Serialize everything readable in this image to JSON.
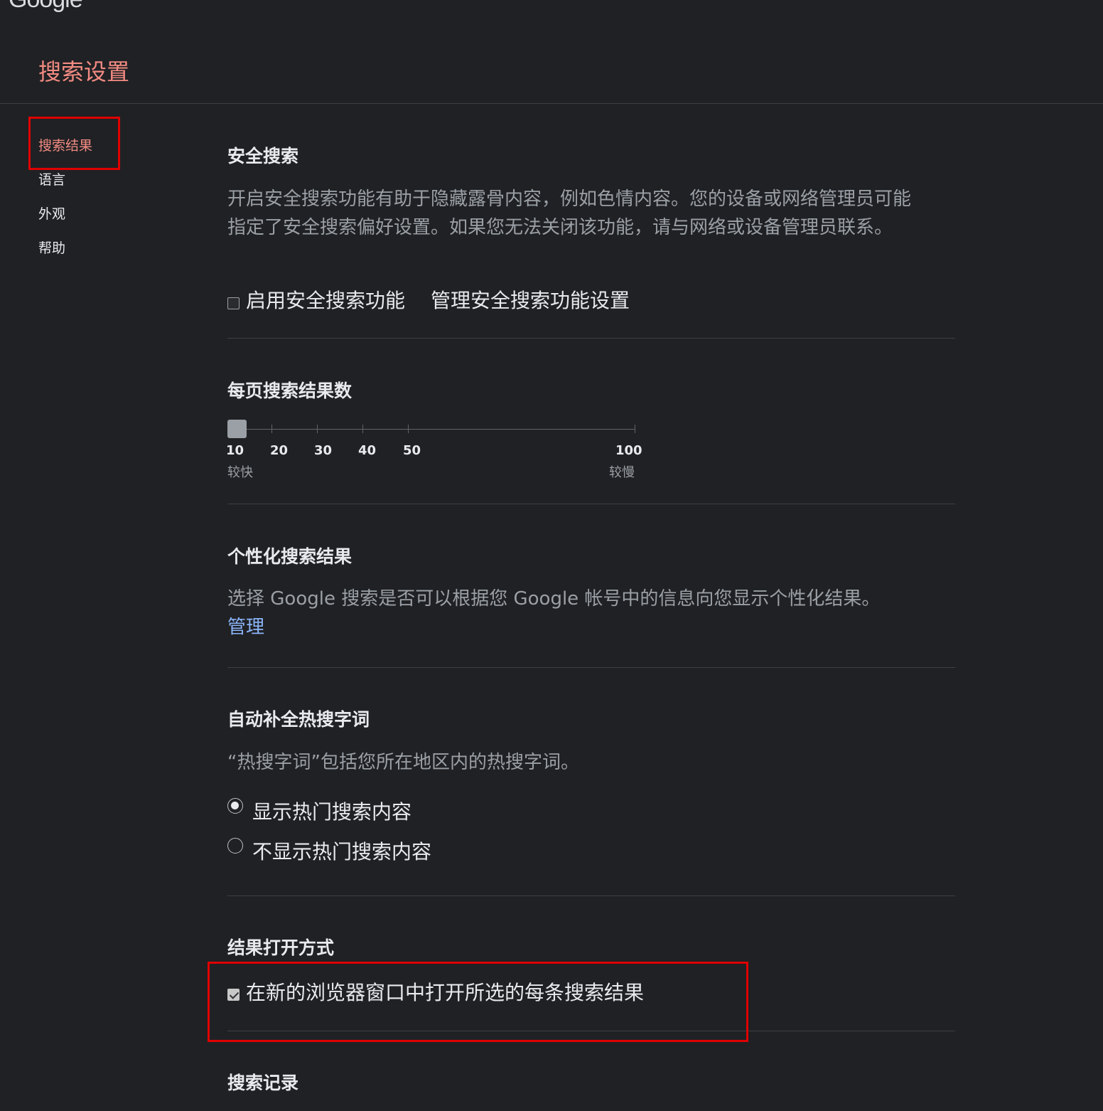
{
  "app": {
    "logo": "Google"
  },
  "header": {
    "title": "搜索设置"
  },
  "sidebar": {
    "items": [
      {
        "label": "搜索结果",
        "active": true
      },
      {
        "label": "语言"
      },
      {
        "label": "外观"
      },
      {
        "label": "帮助"
      }
    ]
  },
  "sections": {
    "safe_search": {
      "title": "安全搜索",
      "description": "开启安全搜索功能有助于隐藏露骨内容，例如色情内容。您的设备或网络管理员可能指定了安全搜索偏好设置。如果您无法关闭该功能，请与网络或设备管理员联系。",
      "checkbox_label": "启用安全搜索功能",
      "checkbox_checked": false,
      "link": "管理安全搜索功能设置"
    },
    "results_per_page": {
      "title": "每页搜索结果数",
      "ticks": [
        "10",
        "20",
        "30",
        "40",
        "50",
        "100"
      ],
      "selected": "10",
      "fast_label": "较快",
      "slow_label": "较慢"
    },
    "personalized": {
      "title": "个性化搜索结果",
      "description": "选择 Google 搜索是否可以根据您 Google 帐号中的信息向您显示个性化结果。",
      "link": "管理"
    },
    "autocomplete": {
      "title": "自动补全热搜字词",
      "description": "“热搜字词”包括您所在地区内的热搜字词。",
      "options": [
        {
          "label": "显示热门搜索内容",
          "selected": true
        },
        {
          "label": "不显示热门搜索内容",
          "selected": false
        }
      ]
    },
    "open_results": {
      "title": "结果打开方式",
      "checkbox_label": "在新的浏览器窗口中打开所选的每条搜索结果",
      "checkbox_checked": true
    },
    "search_history": {
      "title": "搜索记录"
    }
  },
  "colors": {
    "background": "#202124",
    "accent": "#f28b82",
    "link": "#8ab4f8",
    "annotation_box": "#e00000"
  }
}
